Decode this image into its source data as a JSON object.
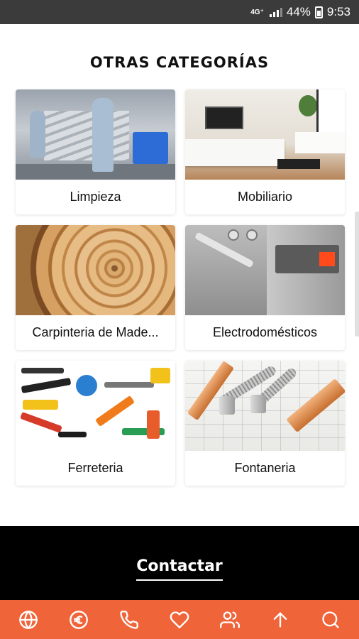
{
  "status_bar": {
    "network": "4G⁺",
    "battery": "44%",
    "time": "9:53"
  },
  "page": {
    "title": "OTRAS CATEGORÍAS"
  },
  "categories": [
    {
      "label": "Limpieza",
      "image": "cleaning-photo"
    },
    {
      "label": "Mobiliario",
      "image": "furniture-photo"
    },
    {
      "label": "Carpinteria de Made...",
      "image": "wood-photo"
    },
    {
      "label": "Electrodomésticos",
      "image": "appliance-photo"
    },
    {
      "label": "Ferreteria",
      "image": "tools-photo"
    },
    {
      "label": "Fontaneria",
      "image": "pipes-photo"
    }
  ],
  "contact": {
    "label": "Contactar"
  },
  "bottom_nav": [
    {
      "icon": "globe-icon"
    },
    {
      "icon": "euro-icon"
    },
    {
      "icon": "phone-icon"
    },
    {
      "icon": "heart-icon"
    },
    {
      "icon": "users-icon"
    },
    {
      "icon": "arrow-up-icon"
    },
    {
      "icon": "search-icon"
    }
  ],
  "colors": {
    "accent": "#f0643a",
    "contact_bg": "#000000",
    "status_bar": "#3b3b3b"
  }
}
